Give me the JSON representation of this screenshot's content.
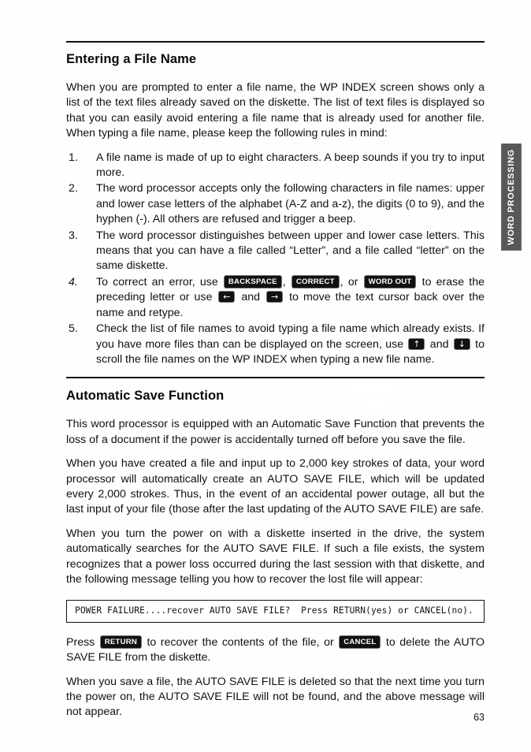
{
  "document": {
    "page_number": "63",
    "side_tab_label": "WORD PROCESSING"
  },
  "section1": {
    "heading": "Entering a File Name",
    "intro": "When you are prompted to enter a file name, the WP INDEX screen shows only a list of the text files already saved on the diskette. The list of text files is displayed so that you can easily avoid entering a file name that is already used for another file. When typing a file name, please keep the following rules in mind:",
    "rules": [
      {
        "number": "1.",
        "text": "A file name is made of up to eight characters. A beep sounds if you try to input more."
      },
      {
        "number": "2.",
        "text": "The word processor accepts only the following characters in file names: upper and lower case letters of the alphabet (A-Z and a-z), the digits (0 to 9), and the hyphen (-). All others are refused and trigger a beep."
      },
      {
        "number": "3.",
        "text": "The word processor distinguishes between upper and lower case letters. This means that you can have a file called “Letter”, and a file called “letter” on the same diskette."
      },
      {
        "number": "4.",
        "text_part1": "To correct an error, use ",
        "key_backspace": "BACKSPACE",
        "text_part2": ", ",
        "key_correct": "CORRECT",
        "text_part3": ", or ",
        "key_wordout": "WORD OUT",
        "text_part4": " to erase the preceding letter or use ",
        "key_left": "←",
        "text_part5": " and ",
        "key_right": "→",
        "text_part6": " to move the text cursor back over the name and retype."
      },
      {
        "number": "5.",
        "text_part1": "Check the list of file names to avoid typing a file name which already exists. If you have more files than can be displayed on the screen, use ",
        "key_up": "↑",
        "text_part2": " and ",
        "key_down": "↓",
        "text_part3": " to scroll the file names on the WP INDEX when typing a new file name."
      }
    ]
  },
  "section2": {
    "heading": "Automatic Save Function",
    "paragraph1": "This word processor is equipped with an Automatic Save Function that prevents the loss of a document if the power is accidentally turned off before you save the file.",
    "paragraph2": "When you have created a file and input up to 2,000 key strokes of data, your word processor will automatically create an AUTO SAVE FILE, which will be updated every 2,000 strokes. Thus, in the event of an accidental power outage, all but the last input of your file (those after the last updating of the AUTO SAVE FILE) are safe.",
    "paragraph3": "When you turn the power on with a diskette inserted in the drive, the system automatically searches for the AUTO SAVE FILE. If such a file exists, the system recognizes that a power loss occurred during the last session with that diskette, and the following message telling you how to recover the lost file will appear:",
    "message_box": "POWER FAILURE....recover AUTO SAVE FILE?  Press RETURN(yes) or CANCEL(no).",
    "paragraph4": {
      "text_part1": "Press ",
      "key_return": "RETURN",
      "text_part2": " to recover the contents of the file, or ",
      "key_cancel": "CANCEL",
      "text_part3": " to delete the AUTO SAVE FILE from the diskette."
    },
    "paragraph5": "When you save a file, the AUTO SAVE FILE is deleted so that the next time you turn the power on, the AUTO SAVE FILE will not be found, and the above message will not appear."
  }
}
